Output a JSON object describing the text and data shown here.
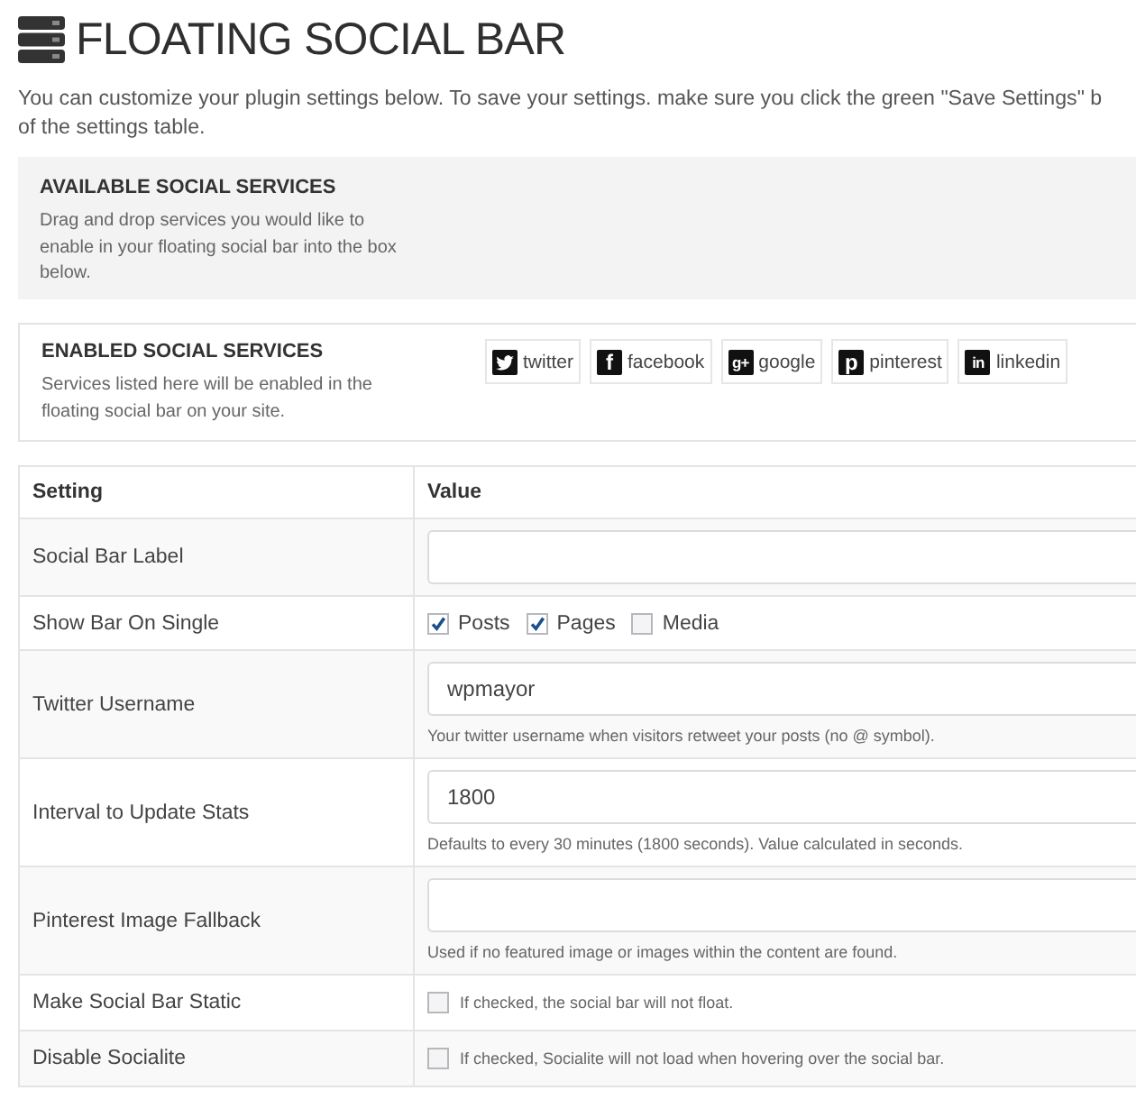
{
  "title": {
    "text": "FLOATING SOCIAL BAR"
  },
  "intro": {
    "lines": [
      "You can customize your plugin settings below. To save your settings. make sure you click the green \"Save Settings\" b",
      "of the settings table."
    ]
  },
  "available_services": {
    "heading": "AVAILABLE SOCIAL SERVICES",
    "description": "Drag and drop services you would like to enable in your floating social bar into the box below."
  },
  "enabled_services": {
    "heading": "ENABLED SOCIAL SERVICES",
    "description": "Services listed here will be enabled in the floating social bar on your site.",
    "services": [
      {
        "label": "twitter",
        "kind": "bird"
      },
      {
        "label": "facebook",
        "kind": "letter",
        "glyph": "f"
      },
      {
        "label": "google",
        "kind": "letter",
        "glyph": "g+"
      },
      {
        "label": "pinterest",
        "kind": "letter",
        "glyph": "p"
      },
      {
        "label": "linkedin",
        "kind": "letter",
        "glyph": "in"
      }
    ]
  },
  "table": {
    "columns": [
      "Setting",
      "Value"
    ],
    "rows": [
      {
        "setting": "Social Bar Label",
        "kind": "text"
      },
      {
        "setting": "Show Bar On Single",
        "kind": "checkboxes",
        "options": [
          {
            "label": "Posts",
            "checked": true
          },
          {
            "label": "Pages",
            "checked": true
          },
          {
            "label": "Media",
            "checked": false
          }
        ]
      },
      {
        "setting": "Twitter Username",
        "kind": "text",
        "value": "wpmayor",
        "help": "Your twitter username when visitors retweet your posts (no @ symbol)."
      },
      {
        "setting": "Interval to Update Stats",
        "kind": "text",
        "value": "1800",
        "help": "Defaults to every 30 minutes (1800 seconds). Value calculated in seconds."
      },
      {
        "setting": "Pinterest Image Fallback",
        "kind": "text",
        "help": "Used if no featured image or images within the content are found."
      },
      {
        "setting": "Make Social Bar Static",
        "kind": "checkbox",
        "checked": false,
        "label": "If checked, the social bar will not float."
      },
      {
        "setting": "Disable Socialite",
        "kind": "checkbox",
        "checked": false,
        "label": "If checked, Socialite will not load when hovering over the social bar."
      }
    ]
  }
}
